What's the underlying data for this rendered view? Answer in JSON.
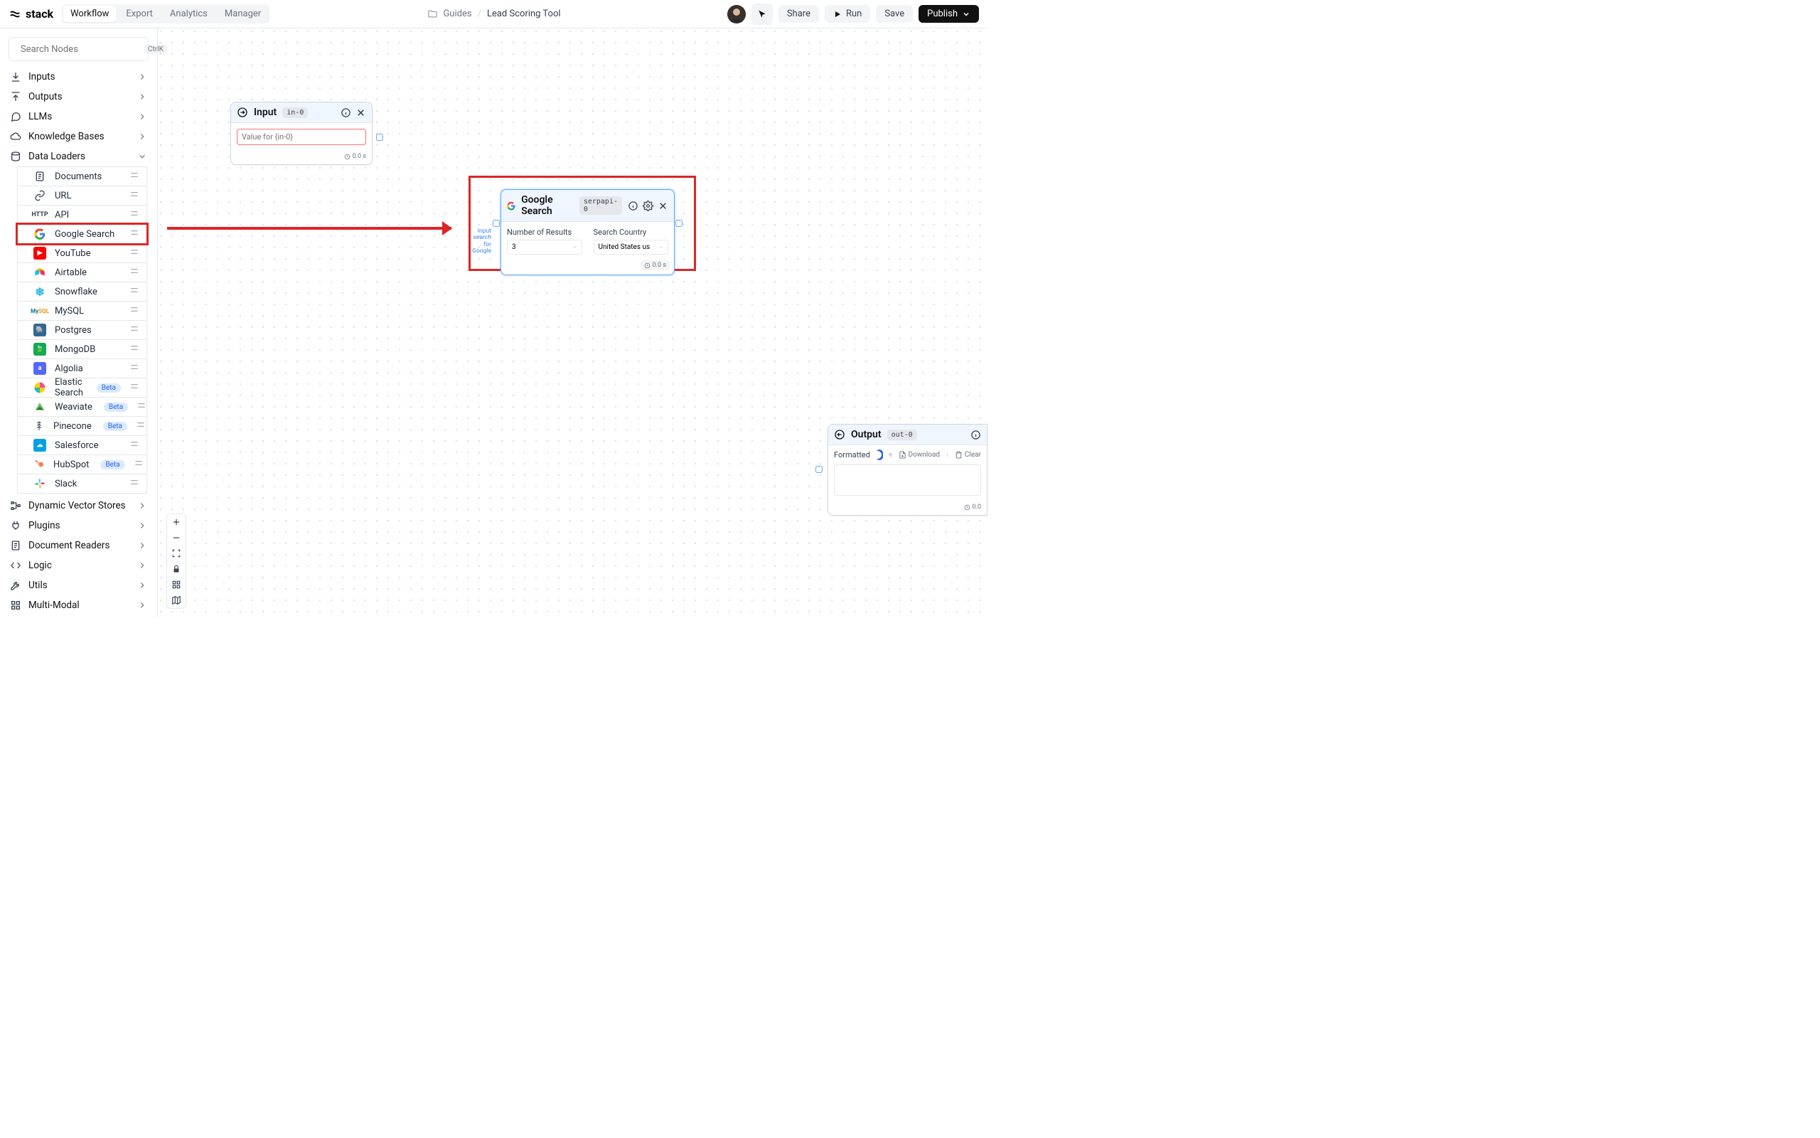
{
  "app": {
    "name": "stack"
  },
  "nav": {
    "tabs": [
      "Workflow",
      "Export",
      "Analytics",
      "Manager"
    ],
    "active": "Workflow"
  },
  "breadcrumb": {
    "folder": "Guides",
    "current": "Lead Scoring Tool"
  },
  "topbar": {
    "share": "Share",
    "run": "Run",
    "save": "Save",
    "publish": "Publish"
  },
  "sidebar": {
    "search_placeholder": "Search Nodes",
    "search_kbd": "CtrlK",
    "groups_top": [
      {
        "label": "Inputs",
        "icon": "download"
      },
      {
        "label": "Outputs",
        "icon": "upload"
      },
      {
        "label": "LLMs",
        "icon": "chat"
      },
      {
        "label": "Knowledge Bases",
        "icon": "cloud"
      }
    ],
    "data_loaders": {
      "label": "Data Loaders",
      "items": [
        {
          "label": "Documents",
          "icon": "doc"
        },
        {
          "label": "URL",
          "icon": "link"
        },
        {
          "label": "API",
          "icon": "http"
        },
        {
          "label": "Google Search",
          "icon": "google",
          "highlighted": true
        },
        {
          "label": "YouTube",
          "icon": "youtube"
        },
        {
          "label": "Airtable",
          "icon": "airtable"
        },
        {
          "label": "Snowflake",
          "icon": "snowflake"
        },
        {
          "label": "MySQL",
          "icon": "mysql"
        },
        {
          "label": "Postgres",
          "icon": "postgres"
        },
        {
          "label": "MongoDB",
          "icon": "mongodb"
        },
        {
          "label": "Algolia",
          "icon": "algolia"
        },
        {
          "label": "Elastic Search",
          "icon": "elastic",
          "badge": "Beta"
        },
        {
          "label": "Weaviate",
          "icon": "weaviate",
          "badge": "Beta"
        },
        {
          "label": "Pinecone",
          "icon": "pinecone",
          "badge": "Beta"
        },
        {
          "label": "Salesforce",
          "icon": "salesforce"
        },
        {
          "label": "HubSpot",
          "icon": "hubspot",
          "badge": "Beta"
        },
        {
          "label": "Slack",
          "icon": "slack"
        }
      ]
    },
    "groups_bottom": [
      {
        "label": "Dynamic Vector Stores",
        "icon": "vectors"
      },
      {
        "label": "Plugins",
        "icon": "plug"
      },
      {
        "label": "Document Readers",
        "icon": "reader"
      },
      {
        "label": "Logic",
        "icon": "code"
      },
      {
        "label": "Utils",
        "icon": "wrench"
      },
      {
        "label": "Multi-Modal",
        "icon": "grid"
      }
    ]
  },
  "nodes": {
    "input": {
      "title": "Input",
      "tag": "in-0",
      "placeholder": "Value for {in-0}",
      "time": "0.0 s"
    },
    "google_search": {
      "title": "Google Search",
      "tag": "serpapi-0",
      "num_results_label": "Number of Results",
      "num_results_value": "3",
      "country_label": "Search Country",
      "country_value": "United States us",
      "time": "0.0 s",
      "input_label_lines": [
        "Input",
        "search",
        "for",
        "Google"
      ]
    },
    "output": {
      "title": "Output",
      "tag": "out-0",
      "formatted_label": "Formatted",
      "download_label": "Download",
      "clear_label": "Clear",
      "time": "0.0"
    }
  }
}
